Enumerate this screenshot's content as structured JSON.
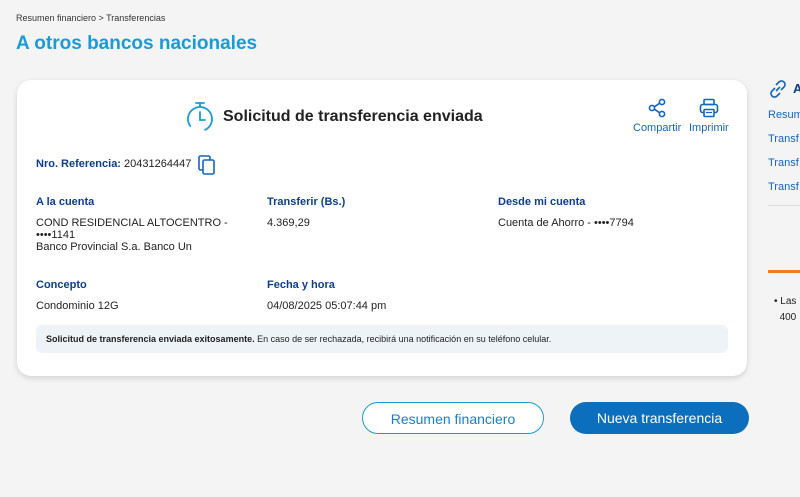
{
  "breadcrumb": "Resumen financiero > Transferencias",
  "page_title": "A otros bancos nacionales",
  "card": {
    "title": "Solicitud de transferencia enviada",
    "share_label": "Compartir",
    "print_label": "Imprimir",
    "ref_label": "Nro. Referencia:",
    "ref_value": "20431264447",
    "fields": {
      "to_account_label": "A la cuenta",
      "to_account_line1": "COND RESIDENCIAL ALTOCENTRO -",
      "to_account_line2": "••••1141",
      "to_account_line3": "Banco Provincial S.a. Banco Un",
      "amount_label": "Transferir (Bs.)",
      "amount_value": "4.369,29",
      "from_label": "Desde mi cuenta",
      "from_value": "Cuenta de Ahorro - ••••7794",
      "concept_label": "Concepto",
      "concept_value": "Condominio 12G",
      "date_label": "Fecha y hora",
      "date_value": "04/08/2025 05:07:44 pm"
    },
    "notice_bold": "Solicitud de transferencia enviada exitosamente.",
    "notice_text": " En caso de ser rechazada, recibirá una notificación en su teléfono celular."
  },
  "buttons": {
    "summary": "Resumen financiero",
    "new_transfer": "Nueva transferencia"
  },
  "sidebar": {
    "heading": "A",
    "links": [
      "Resum",
      "Transf",
      "Transf",
      "Transf"
    ],
    "bullet": "Las",
    "bullet_line2": "400"
  },
  "colors": {
    "title_blue": "#1a9bd6",
    "label_navy": "#0d3e8a",
    "primary_button": "#0b6fbe",
    "accent_orange": "#f07b22"
  }
}
